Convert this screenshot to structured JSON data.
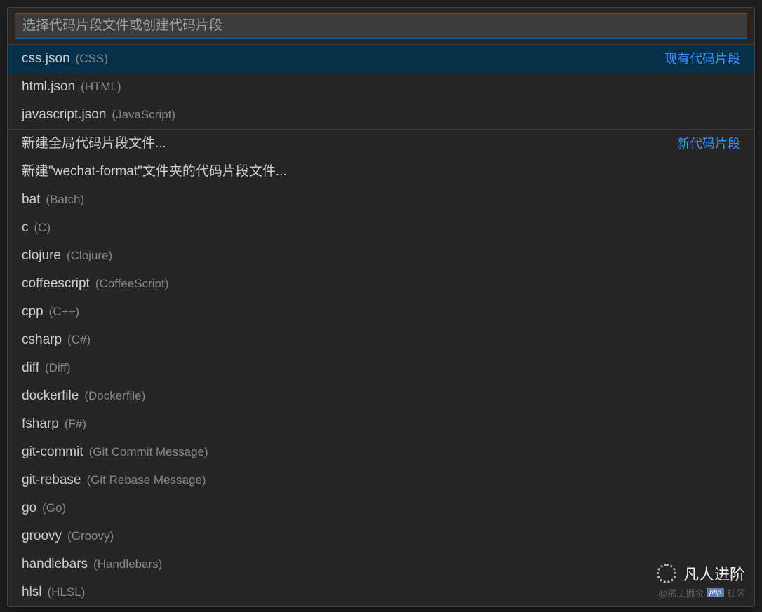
{
  "input": {
    "placeholder": "选择代码片段文件或创建代码片段",
    "value": ""
  },
  "groups": [
    {
      "badge": "现有代码片段",
      "items": [
        {
          "name": "css.json",
          "desc": "(CSS)",
          "selected": true
        },
        {
          "name": "html.json",
          "desc": "(HTML)",
          "selected": false
        },
        {
          "name": "javascript.json",
          "desc": "(JavaScript)",
          "selected": false
        }
      ]
    },
    {
      "badge": "新代码片段",
      "items": [
        {
          "name": "新建全局代码片段文件...",
          "desc": "",
          "selected": false
        },
        {
          "name": "新建\"wechat-format\"文件夹的代码片段文件...",
          "desc": "",
          "selected": false
        },
        {
          "name": "bat",
          "desc": "(Batch)",
          "selected": false
        },
        {
          "name": "c",
          "desc": "(C)",
          "selected": false
        },
        {
          "name": "clojure",
          "desc": "(Clojure)",
          "selected": false
        },
        {
          "name": "coffeescript",
          "desc": "(CoffeeScript)",
          "selected": false
        },
        {
          "name": "cpp",
          "desc": "(C++)",
          "selected": false
        },
        {
          "name": "csharp",
          "desc": "(C#)",
          "selected": false
        },
        {
          "name": "diff",
          "desc": "(Diff)",
          "selected": false
        },
        {
          "name": "dockerfile",
          "desc": "(Dockerfile)",
          "selected": false
        },
        {
          "name": "fsharp",
          "desc": "(F#)",
          "selected": false
        },
        {
          "name": "git-commit",
          "desc": "(Git Commit Message)",
          "selected": false
        },
        {
          "name": "git-rebase",
          "desc": "(Git Rebase Message)",
          "selected": false
        },
        {
          "name": "go",
          "desc": "(Go)",
          "selected": false
        },
        {
          "name": "groovy",
          "desc": "(Groovy)",
          "selected": false
        },
        {
          "name": "handlebars",
          "desc": "(Handlebars)",
          "selected": false
        },
        {
          "name": "hlsl",
          "desc": "(HLSL)",
          "selected": false
        }
      ]
    }
  ],
  "watermark": {
    "title": "凡人进阶",
    "subtitle_prefix": "@稀土掘金",
    "subtitle_tag": "php",
    "subtitle_suffix": "社区"
  }
}
